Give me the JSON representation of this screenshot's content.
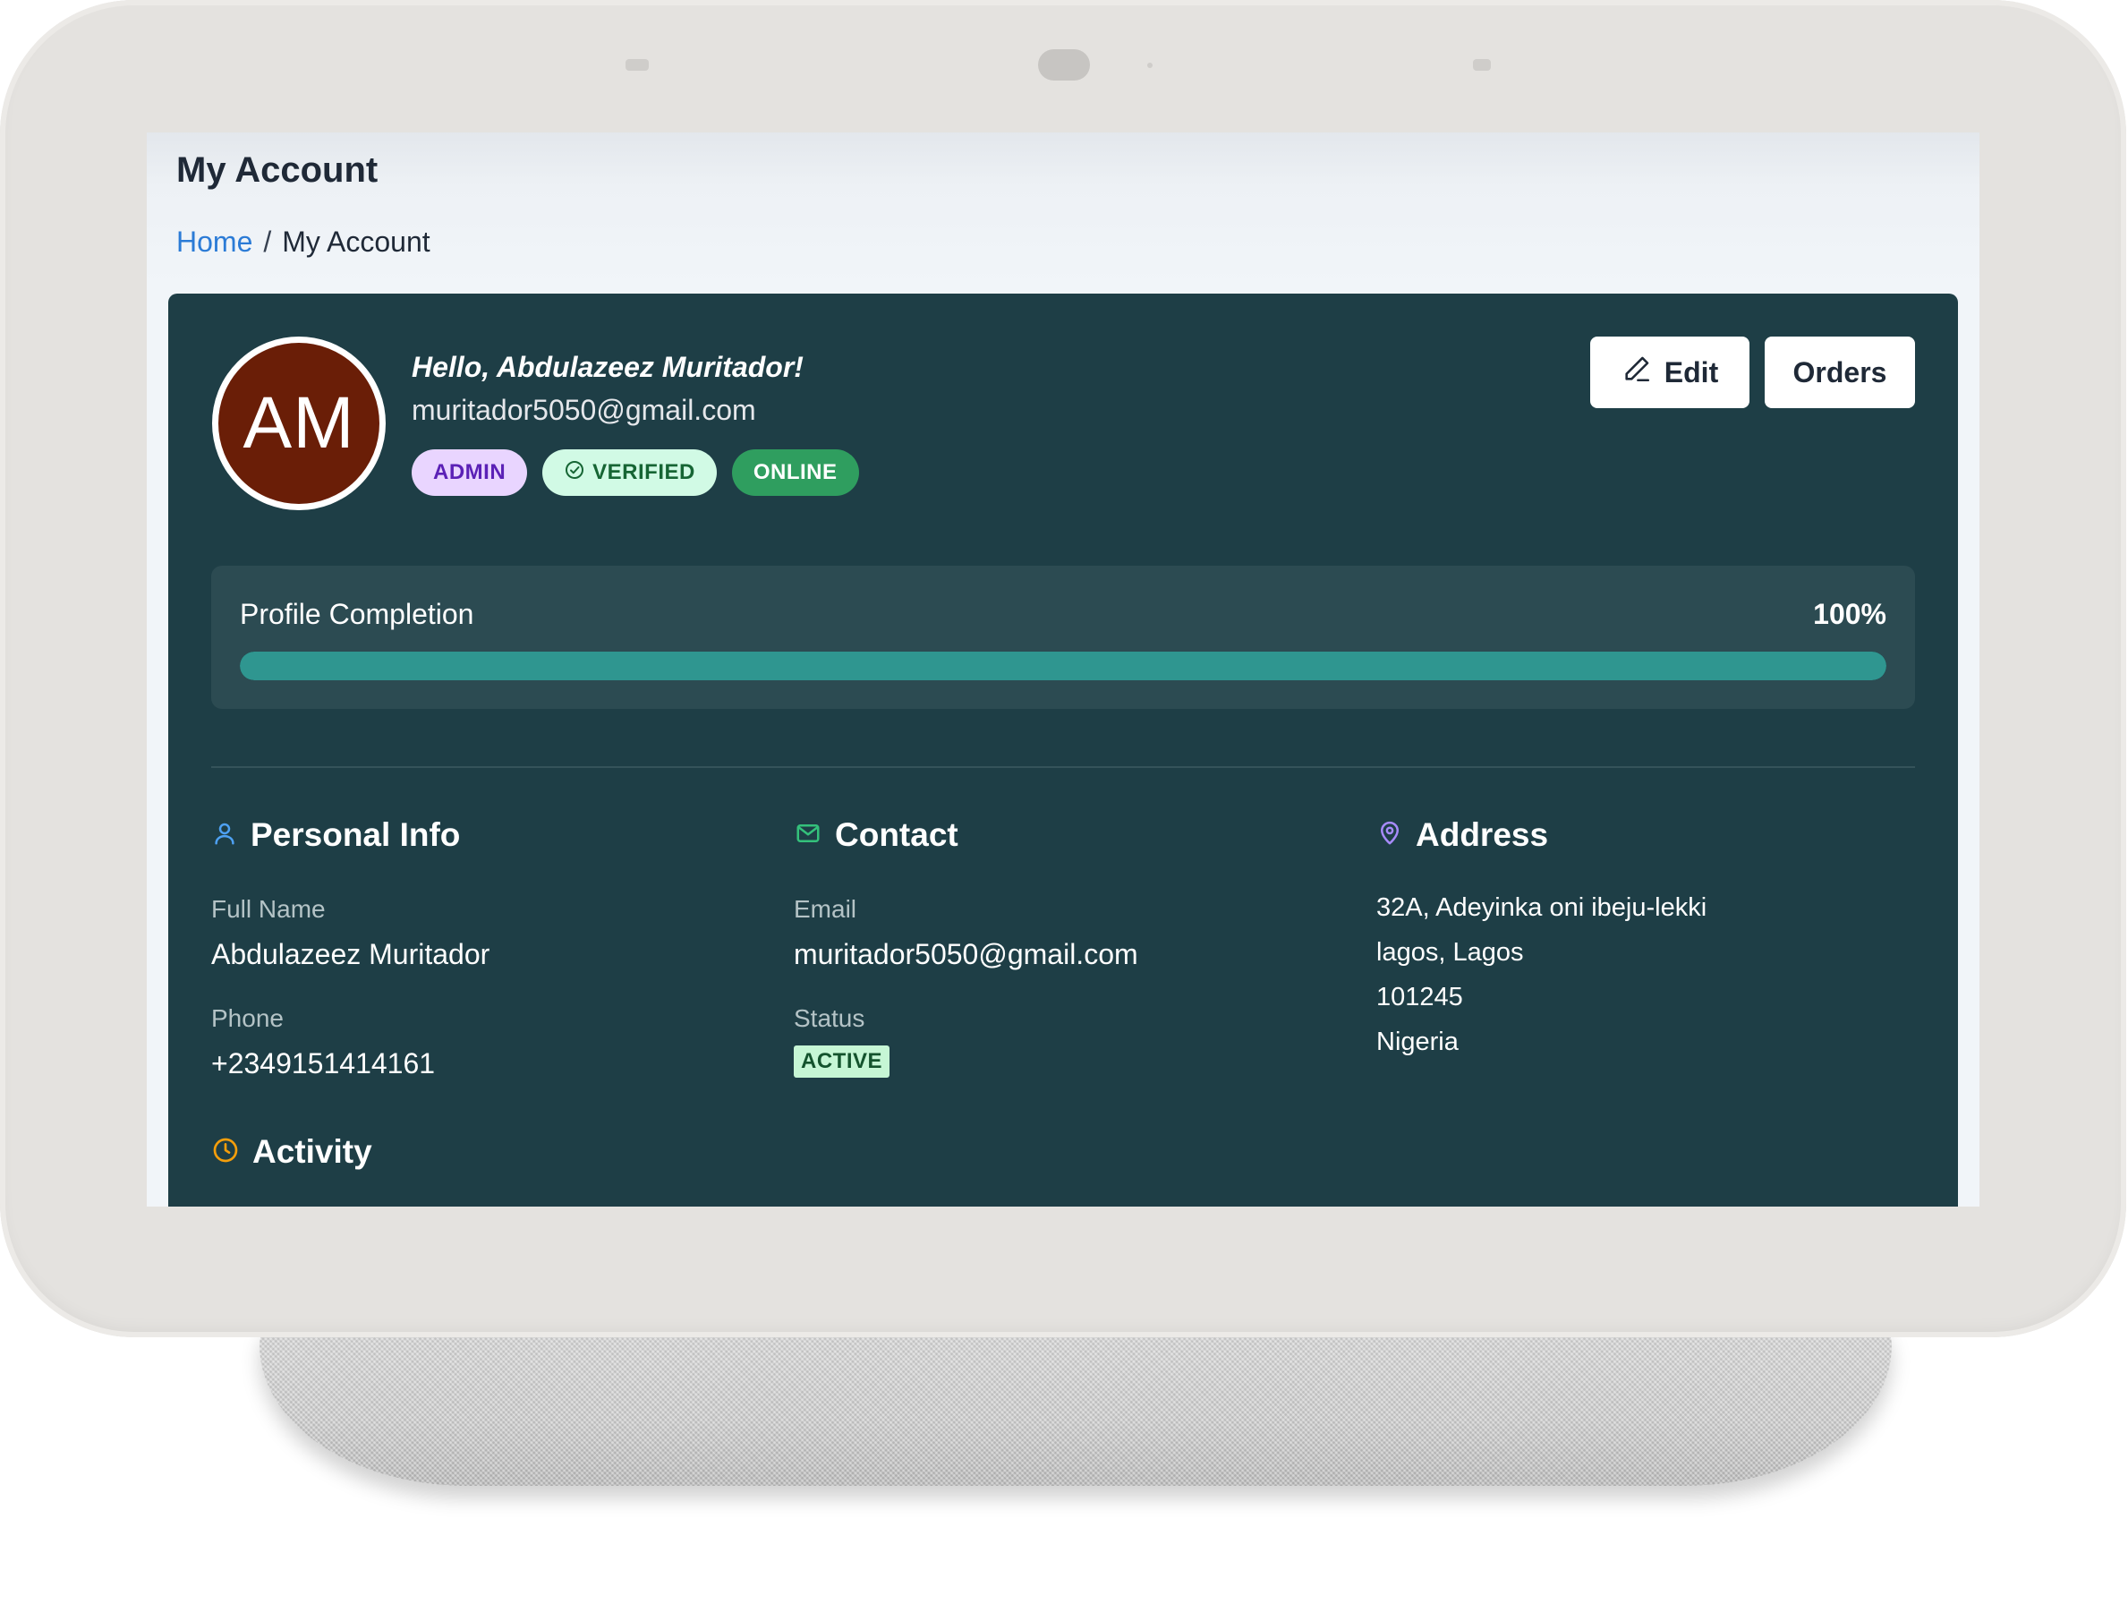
{
  "page": {
    "title": "My Account",
    "breadcrumb": {
      "home": "Home",
      "separator": "/",
      "current": "My Account"
    }
  },
  "profile": {
    "initials": "AM",
    "greeting": "Hello, Abdulazeez Muritador!",
    "email": "muritador5050@gmail.com",
    "badges": {
      "admin": "ADMIN",
      "verified": "VERIFIED",
      "online": "ONLINE"
    }
  },
  "actions": {
    "edit_label": "Edit",
    "orders_label": "Orders"
  },
  "completion": {
    "label": "Profile Completion",
    "display": "100%",
    "percent": 100
  },
  "personal_info": {
    "title": "Personal Info",
    "full_name_label": "Full Name",
    "full_name": "Abdulazeez Muritador",
    "phone_label": "Phone",
    "phone": "+2349151414161"
  },
  "contact": {
    "title": "Contact",
    "email_label": "Email",
    "email": "muritador5050@gmail.com",
    "status_label": "Status",
    "status": "ACTIVE"
  },
  "address": {
    "title": "Address",
    "street": "32A, Adeyinka oni ibeju-lekki",
    "city_state": "lagos, Lagos",
    "postal_code": "101245",
    "country": "Nigeria"
  },
  "activity": {
    "title": "Activity"
  },
  "colors": {
    "card_bg": "#1e3e46",
    "avatar_bg": "#6a1e07",
    "progress_fill": "#2f9690",
    "link": "#2b7bd6",
    "personal_icon": "#4ea1f3",
    "contact_icon": "#34c17b",
    "address_icon": "#a78bfa",
    "activity_icon": "#f59e0b"
  },
  "icons": {
    "edit": "pencil-icon",
    "verified": "check-circle-icon",
    "personal_info": "user-icon",
    "contact": "mail-icon",
    "address": "map-pin-icon",
    "activity": "clock-icon"
  }
}
